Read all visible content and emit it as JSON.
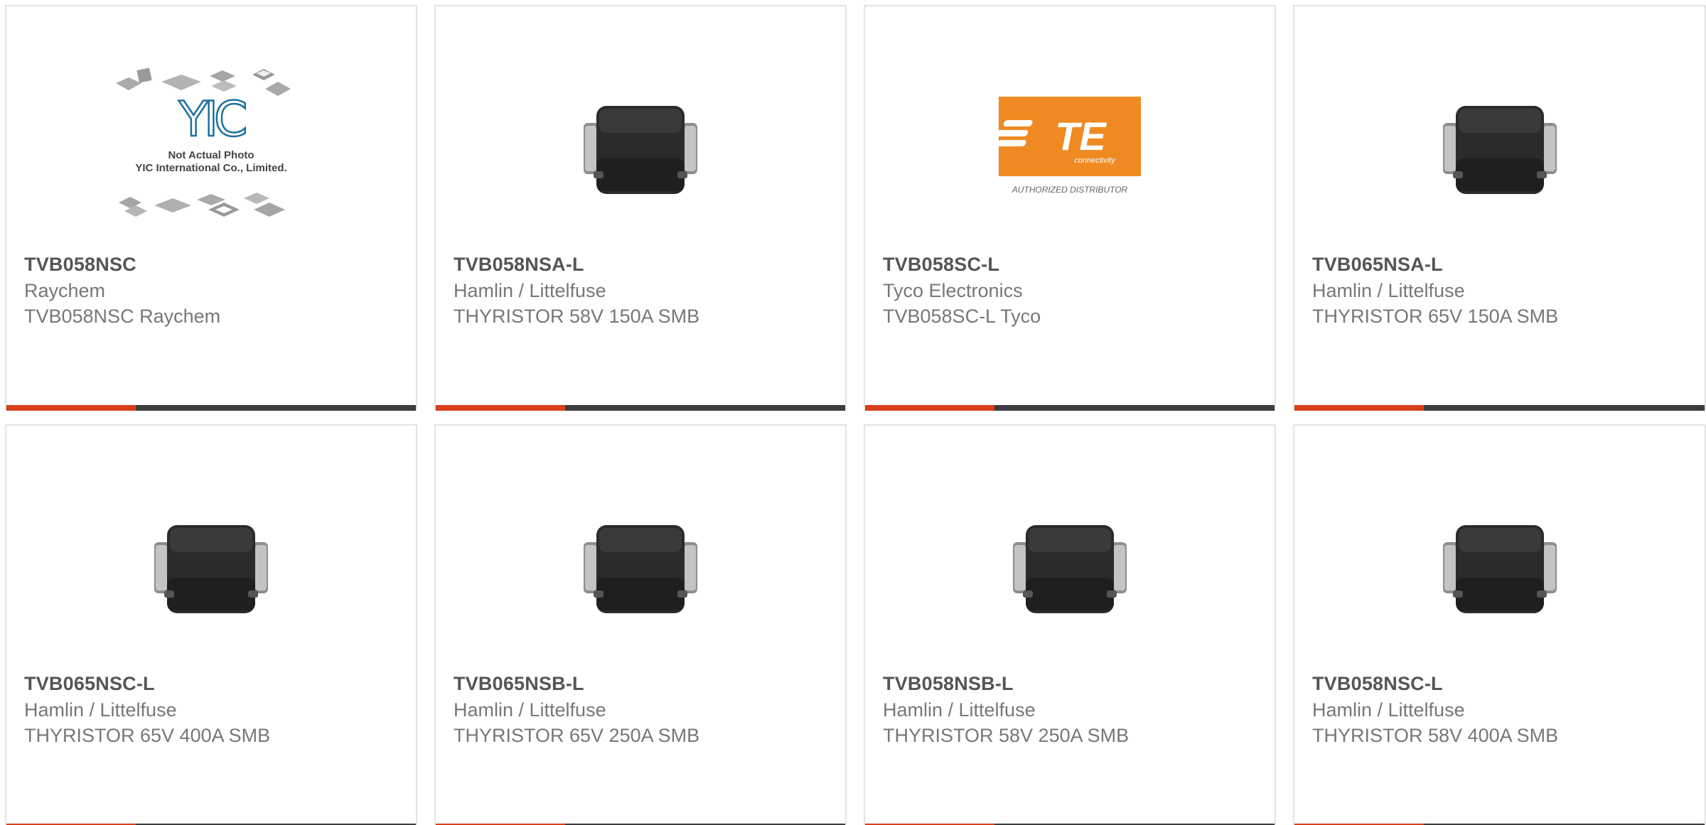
{
  "colors": {
    "accent": "#d8401c",
    "bar_dark": "#3d3d3d",
    "te_orange": "#ef8a22"
  },
  "products": [
    {
      "part": "TVB058NSC",
      "maker": "Raychem",
      "desc": "TVB058NSC Raychem",
      "image": "not-actual-photo",
      "image_text_1": "Not Actual Photo",
      "image_text_2": "YIC International Co., Limited.",
      "image_logo_text": "YIC"
    },
    {
      "part": "TVB058NSA-L",
      "maker": "Hamlin / Littelfuse",
      "desc": "THYRISTOR 58V 150A SMB",
      "image": "smb-package"
    },
    {
      "part": "TVB058SC-L",
      "maker": "Tyco Electronics",
      "desc": "TVB058SC-L Tyco",
      "image": "te-logo",
      "image_logo_text": "TE",
      "image_logo_sub": "connectivity",
      "image_caption": "AUTHORIZED DISTRIBUTOR"
    },
    {
      "part": "TVB065NSA-L",
      "maker": "Hamlin / Littelfuse",
      "desc": "THYRISTOR 65V 150A SMB",
      "image": "smb-package"
    },
    {
      "part": "TVB065NSC-L",
      "maker": "Hamlin / Littelfuse",
      "desc": "THYRISTOR 65V 400A SMB",
      "image": "smb-package"
    },
    {
      "part": "TVB065NSB-L",
      "maker": "Hamlin / Littelfuse",
      "desc": "THYRISTOR 65V 250A SMB",
      "image": "smb-package"
    },
    {
      "part": "TVB058NSB-L",
      "maker": "Hamlin / Littelfuse",
      "desc": "THYRISTOR 58V 250A SMB",
      "image": "smb-package"
    },
    {
      "part": "TVB058NSC-L",
      "maker": "Hamlin / Littelfuse",
      "desc": "THYRISTOR 58V 400A SMB",
      "image": "smb-package"
    }
  ]
}
